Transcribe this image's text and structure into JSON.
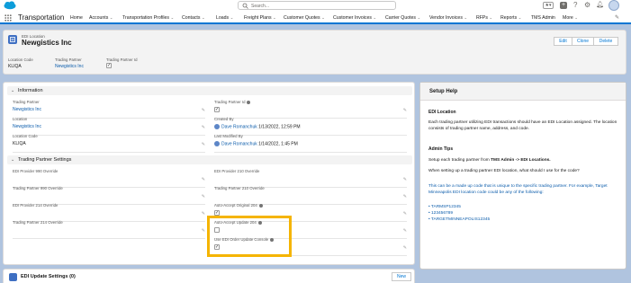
{
  "search": {
    "placeholder": "Search..."
  },
  "nav": {
    "app_name": "Transportation",
    "items": [
      "Home",
      "Accounts",
      "Transportation Profiles",
      "Contacts",
      "Loads",
      "Freight Plans",
      "Customer Quotes",
      "Customer Invoices",
      "Carrier Quotes",
      "Vendor Invoices",
      "RFPs",
      "Reports",
      "TMS Admin",
      "More"
    ]
  },
  "record": {
    "object_label": "EDI Location",
    "title": "Newgistics Inc",
    "buttons": {
      "edit": "Edit",
      "clone": "Clone",
      "delete": "Delete"
    },
    "highlights": [
      {
        "label": "Location Code",
        "value": "KLIQA"
      },
      {
        "label": "Trading Partner",
        "value": "Newgistics Inc"
      },
      {
        "label": "Trading Partner Id",
        "value": "✓"
      }
    ]
  },
  "information": {
    "header": "Information",
    "left": [
      {
        "label": "Trading Partner",
        "value": "Newgistics Inc"
      },
      {
        "label": "Location",
        "value": "Newgistics Inc"
      },
      {
        "label": "Location Code",
        "value": "KLIQA"
      }
    ],
    "right": [
      {
        "label": "Trading Partner Id",
        "value": "✓"
      },
      {
        "label": "Created By",
        "user": "Dave Romanchuk",
        "date": "1/13/2022, 12:59 PM"
      },
      {
        "label": "Last Modified By",
        "user": "Dave Romanchuk",
        "date": "1/14/2022, 1:45 PM"
      }
    ]
  },
  "tps": {
    "header": "Trading Partner Settings",
    "left": [
      {
        "label": "EDI Provider 990 Override"
      },
      {
        "label": "Trading Partner 990 Override"
      },
      {
        "label": "EDI Provider 214 Override"
      },
      {
        "label": "Trading Partner 214 Override"
      }
    ],
    "right": [
      {
        "label": "EDI Provider 210 Override"
      },
      {
        "label": "Trading Partner 210 Override"
      },
      {
        "label": "Auto-Accept Original 204",
        "value": "✓"
      },
      {
        "label": "Auto-Accept Update 204",
        "value": ""
      },
      {
        "label": "Use EDI Order Update Console",
        "value": "✓"
      }
    ]
  },
  "setup_help": {
    "title": "Setup Help",
    "edi_location_heading": "EDI Location",
    "edi_location_text": "Each trading partner utilizing EDI transactions should have an EDI Location assigned. The location consists of trading partner name, address, and code.",
    "admin_tips_heading": "Admin Tips",
    "tip1_pre": "Setup each trading partner from ",
    "tip1_bold": "TMS Admin -> EDI Locations.",
    "tip2": "When setting up a trading partner EDI location, what should I use for the code?",
    "tip3": "This can be a made up code that is unique to the specific trading partner. For example, Target Minneapolis EDI location code could be any of the following:",
    "codes": [
      "• TARMSP12345",
      "• 123456789",
      "• TARGETMINNEAPOLIS12345"
    ]
  },
  "edi_update": {
    "title": "EDI Update Settings (0)",
    "new_label": "New"
  },
  "colors": {
    "highlight_box": "#f5b400",
    "brand": "#0176d3",
    "background": "#b0c4df"
  }
}
